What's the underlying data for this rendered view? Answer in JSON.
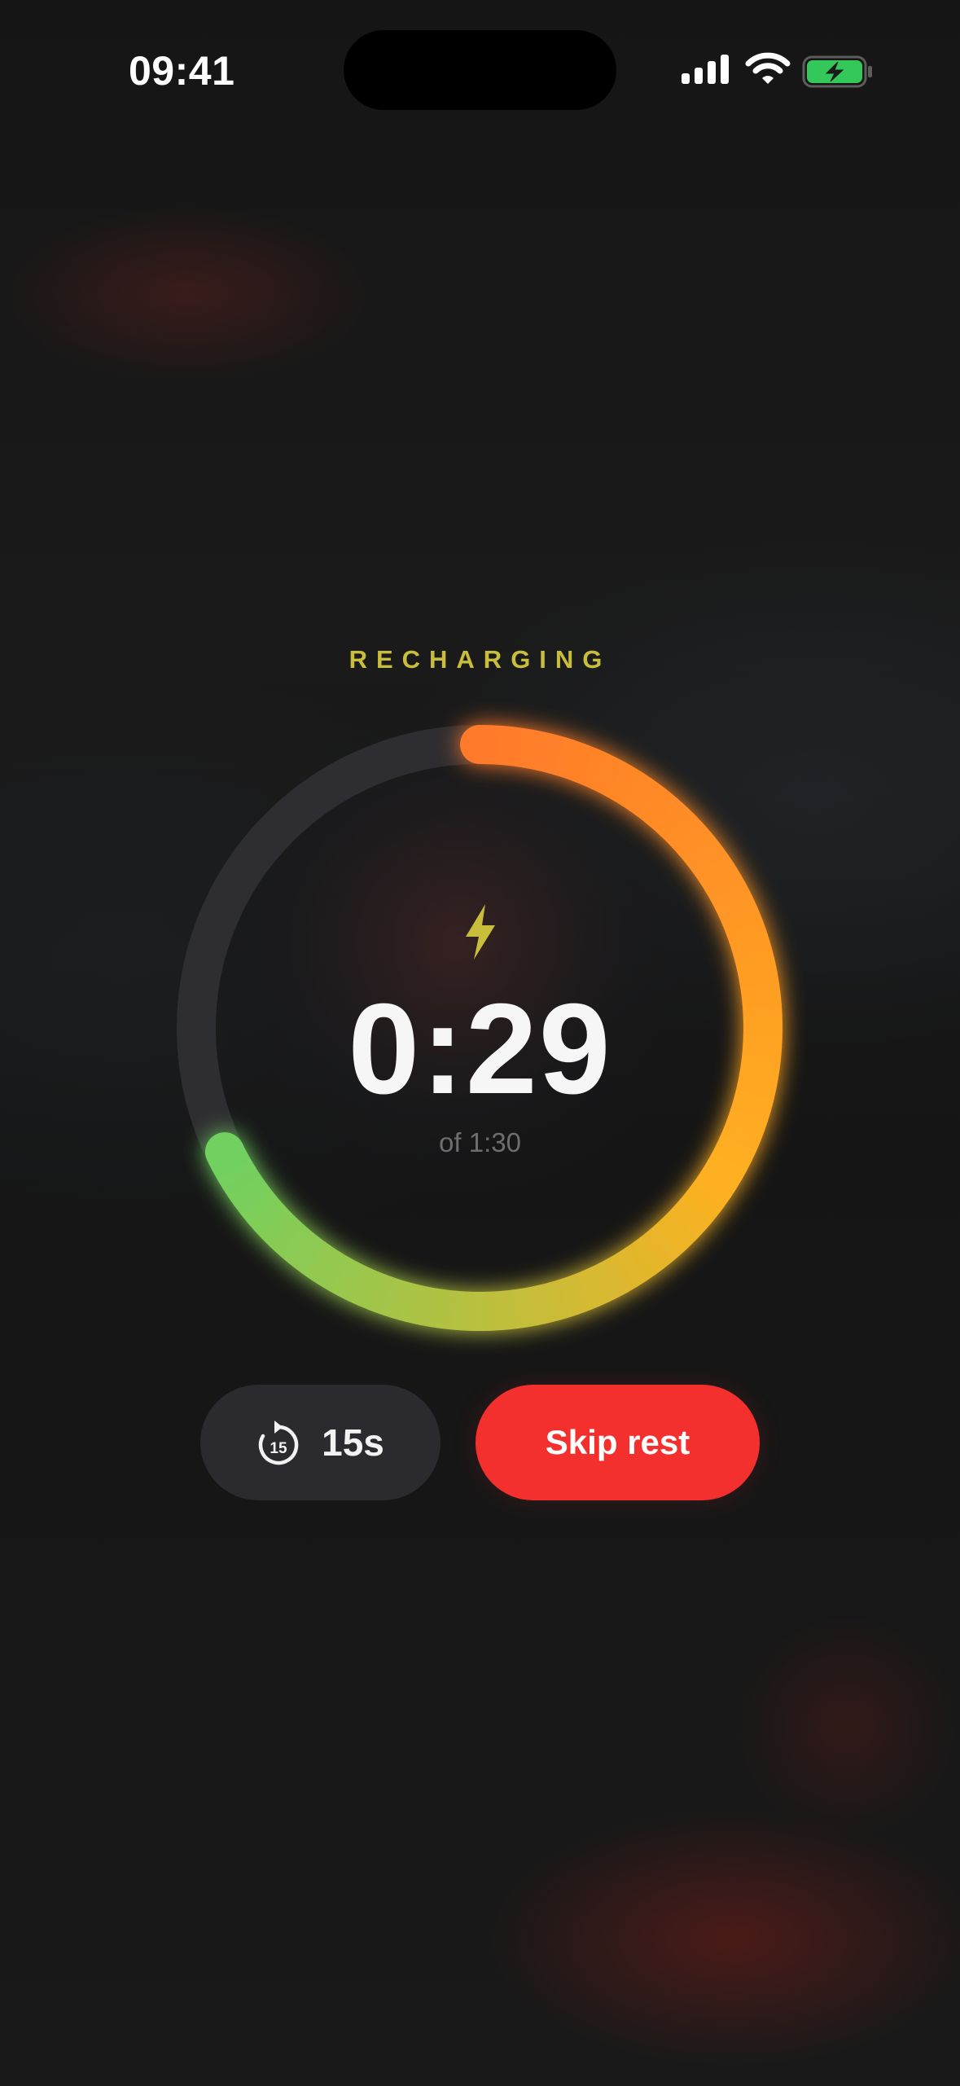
{
  "status_bar": {
    "time": "09:41",
    "signal_icon": "cellular-signal-icon",
    "wifi_icon": "wifi-icon",
    "battery_icon": "battery-charging-icon",
    "battery_color": "#34c759"
  },
  "rest_timer": {
    "mode_label": "RECHARGING",
    "icon": "lightning-bolt-icon",
    "remaining": "0:29",
    "total_label": "of 1:30",
    "progress_fraction": 0.678,
    "colors": {
      "label": "#c9bd3c",
      "track": "#2e2d31",
      "gradient_start": "#ff7a2a",
      "gradient_mid": "#ffb020",
      "gradient_end": "#6fd160"
    }
  },
  "actions": {
    "add_time_icon": "rotate-15-seconds-icon",
    "add_time_label": "15s",
    "skip_label": "Skip rest",
    "skip_color": "#f4302e"
  }
}
